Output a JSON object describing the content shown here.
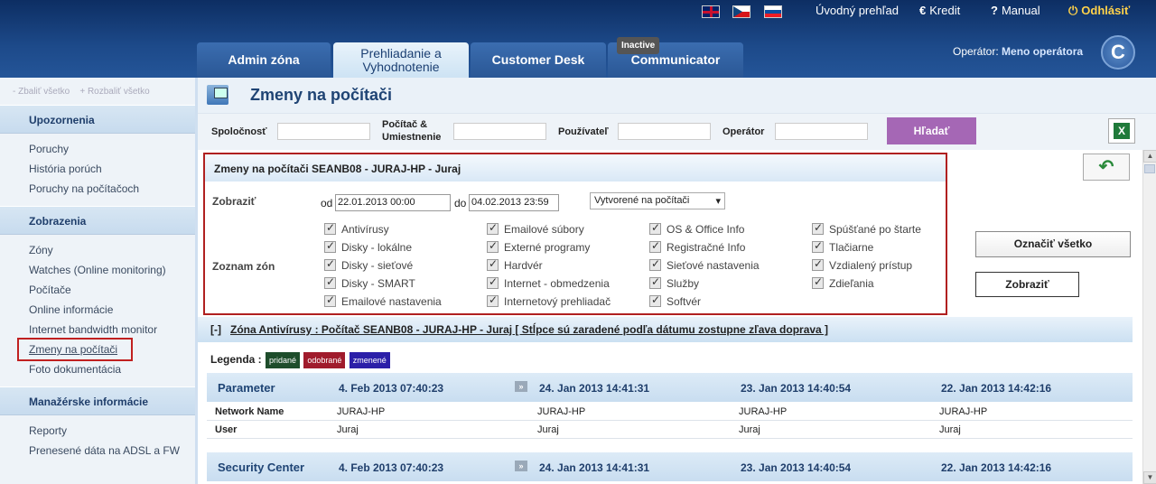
{
  "header": {
    "links": {
      "home": "Úvodný prehľad",
      "credit": "Kredit",
      "manual": "Manual",
      "logout": "Odhlásiť"
    },
    "icons": {
      "credit": "€",
      "manual": "?",
      "logout": "⏻"
    },
    "operator_label": "Operátor:",
    "operator_name": "Meno operátora",
    "logo": "C"
  },
  "tabs": [
    {
      "label": "Admin zóna"
    },
    {
      "label1": "Prehliadanie a",
      "label2": "Vyhodnotenie"
    },
    {
      "label": "Customer Desk"
    },
    {
      "label": "Communicator",
      "badge": "Inactive"
    }
  ],
  "sidebar": {
    "collapse_all": "- Zbaliť všetko",
    "expand_all": "+ Rozbaliť všetko",
    "sections": [
      {
        "title": "Upozornenia",
        "items": [
          "Poruchy",
          "História porúch",
          "Poruchy na počítačoch"
        ]
      },
      {
        "title": "Zobrazenia",
        "items": [
          "Zóny",
          "Watches (Online monitoring)",
          "Počítače",
          "Online informácie",
          "Internet bandwidth monitor",
          "Zmeny na počítači",
          "Foto dokumentácia"
        ]
      },
      {
        "title": "Manažérske informácie",
        "items": [
          "Reporty",
          "Prenesené dáta na ADSL a FW"
        ]
      }
    ]
  },
  "page": {
    "title": "Zmeny na počítači",
    "filters": {
      "company": "Spoločnosť",
      "computer1": "Počítač &",
      "computer2": "Umiestnenie",
      "user": "Používateľ",
      "operator": "Operátor",
      "search": "Hľadať"
    },
    "panel": {
      "title": "Zmeny na počítači SEANB08 - JURAJ-HP - Juraj",
      "show_label": "Zobraziť",
      "from_label": "od",
      "from_value": "22.01.2013 00:00",
      "to_label": "do",
      "to_value": "04.02.2013 23:59",
      "select_value": "Vytvorené na počítači",
      "zones_label": "Zoznam zón",
      "zones": [
        "Antivírusy",
        "Disky - lokálne",
        "Disky - sieťové",
        "Disky - SMART",
        "Emailové nastavenia",
        "Emailové súbory",
        "Externé programy",
        "Hardvér",
        "Internet - obmedzenia",
        "Internetový prehliadač",
        "OS & Office Info",
        "Registračné Info",
        "Sieťové nastavenia",
        "Služby",
        "Softvér",
        "Spúšťané po štarte",
        "Tlačiarne",
        "Vzdialený prístup",
        "Zdieľania"
      ]
    },
    "mark_all": "Označiť všetko",
    "show": "Zobraziť",
    "zone_bar": {
      "toggle": "[-]",
      "text": "Zóna Antivírusy : Počítač SEANB08 - JURAJ-HP - Juraj [ Stĺpce sú zaradené podľa dátumu zostupne zľava doprava ]"
    },
    "legend": {
      "label": "Legenda :",
      "added": "pridané",
      "removed": "odobrané",
      "changed": "zmenené",
      "colors": {
        "added": "#1e4d2b",
        "removed": "#a01b2c",
        "changed": "#2b1fa8"
      }
    },
    "tables": [
      {
        "title": "Parameter",
        "dates": [
          "4. Feb 2013 07:40:23",
          "24. Jan 2013 14:41:31",
          "23. Jan 2013 14:40:54",
          "22. Jan 2013 14:42:16"
        ],
        "rows": [
          {
            "key": "Network Name",
            "vals": [
              "JURAJ-HP",
              "JURAJ-HP",
              "JURAJ-HP",
              "JURAJ-HP"
            ]
          },
          {
            "key": "User",
            "vals": [
              "Juraj",
              "Juraj",
              "Juraj",
              "Juraj"
            ]
          }
        ]
      },
      {
        "title": "Security Center",
        "dates": [
          "4. Feb 2013 07:40:23",
          "24. Jan 2013 14:41:31",
          "23. Jan 2013 14:40:54",
          "22. Jan 2013 14:42:16"
        ],
        "rows": []
      }
    ],
    "arrow": "»"
  }
}
